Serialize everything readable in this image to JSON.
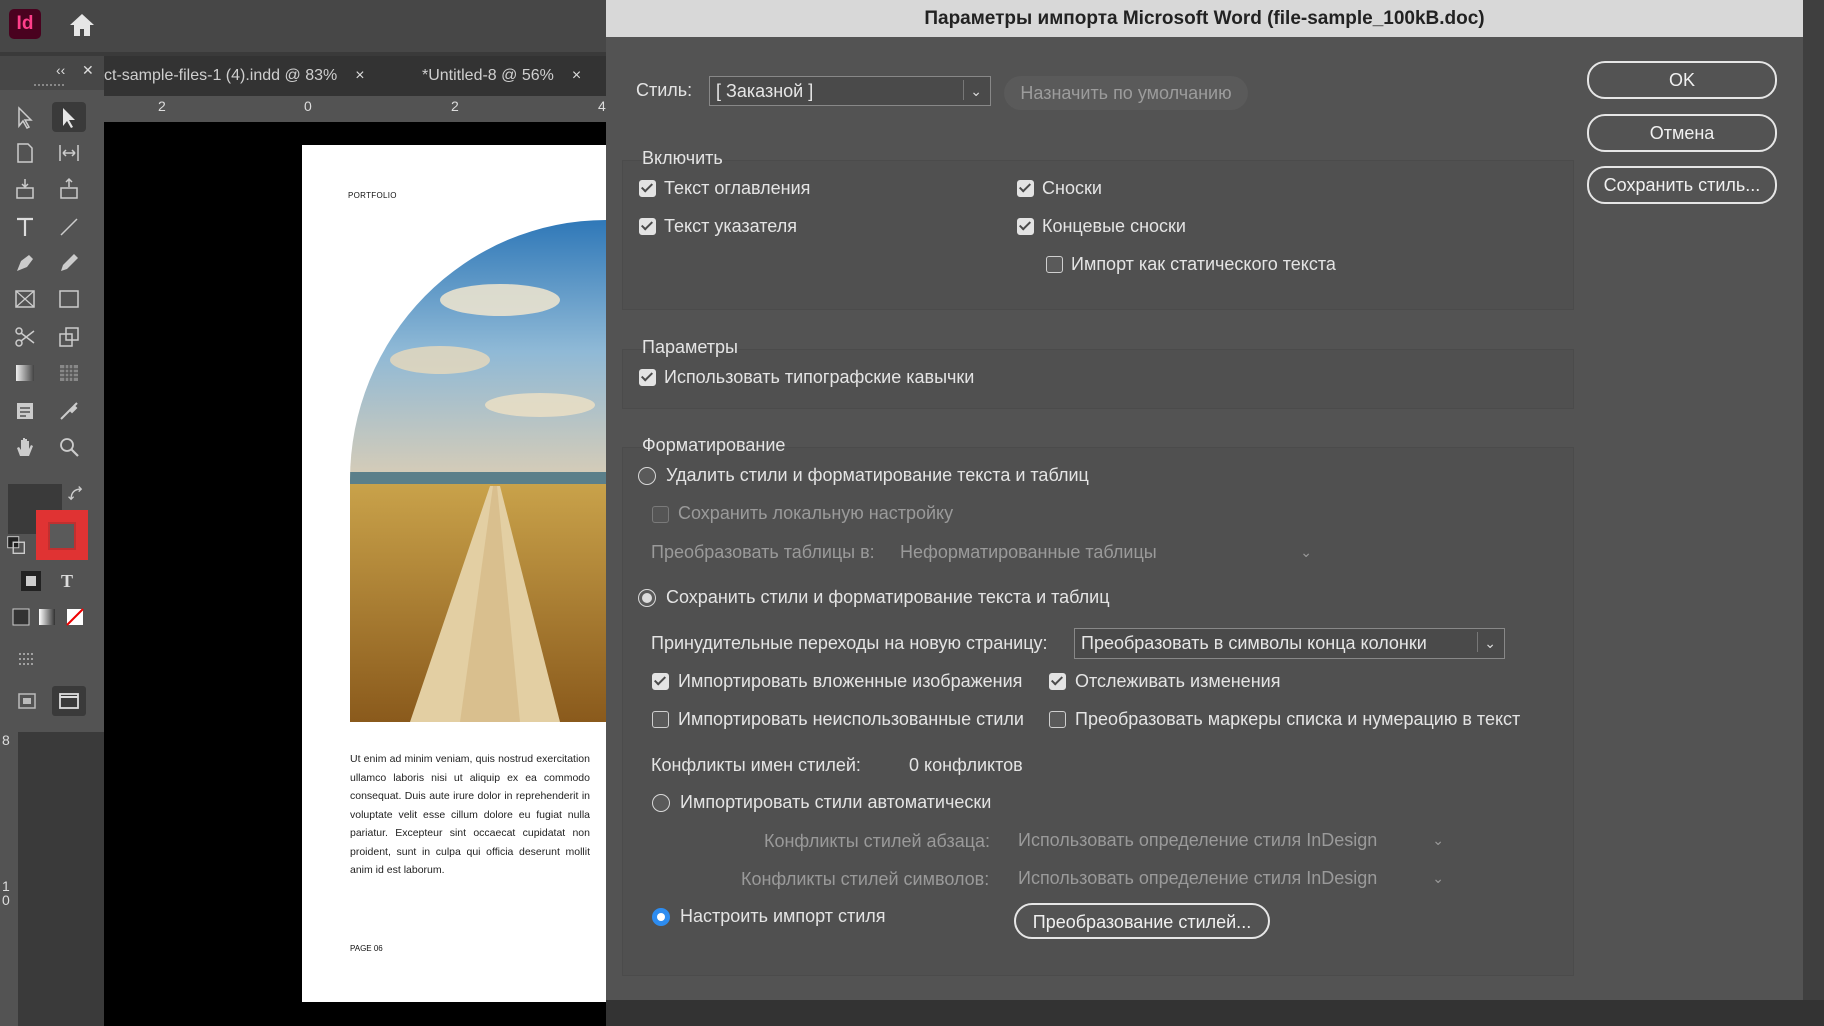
{
  "app": {
    "logo": "Id",
    "tabs": [
      {
        "label": "ct-sample-files-1 (4).indd @ 83%",
        "close": "×"
      },
      {
        "label": "*Untitled-8 @ 56%",
        "close": "×"
      }
    ],
    "ruler_top": [
      "2",
      "0",
      "2",
      "4"
    ],
    "ruler_left": [
      "8",
      "1",
      "0"
    ],
    "panel_controls": {
      "collapse": "‹‹",
      "close": "✕"
    },
    "type_tool_glyph": "T",
    "page": {
      "header": "PORTFOLIO",
      "body": "Ut enim ad minim veniam, quis nostrud exercitation ullamco laboris nisi ut aliquip ex ea commodo consequat. Duis aute irure dolor in reprehenderit in voluptate velit esse cillum dolore eu fugiat nulla pariatur. Excepteur sint occaecat cupidatat non proident, sunt in culpa qui officia deserunt mollit anim id est laborum.",
      "footer": "PAGE 06"
    }
  },
  "dialog": {
    "title": "Параметры импорта Microsoft Word (file-sample_100kB.doc)",
    "style_label": "Стиль:",
    "style_value": "[ Заказной ]",
    "set_default_label": "Назначить по умолчанию",
    "buttons": {
      "ok": "OK",
      "cancel": "Отмена",
      "save_style": "Сохранить стиль..."
    },
    "include": {
      "heading": "Включить",
      "toc_text": {
        "label": "Текст оглавления",
        "checked": true
      },
      "index_text": {
        "label": "Текст указателя",
        "checked": true
      },
      "footnotes": {
        "label": "Сноски",
        "checked": true
      },
      "endnotes": {
        "label": "Концевые сноски",
        "checked": true
      },
      "static_text": {
        "label": "Импорт как статического текста",
        "checked": false
      }
    },
    "options": {
      "heading": "Параметры",
      "typographer_quotes": {
        "label": "Использовать типографские кавычки",
        "checked": true
      }
    },
    "formatting": {
      "heading": "Форматирование",
      "remove_styles": {
        "label": "Удалить стили и форматирование текста и таблиц",
        "selected": false
      },
      "preserve_local": {
        "label": "Сохранить локальную настройку",
        "checked": false,
        "disabled": true
      },
      "convert_tables_label": "Преобразовать таблицы в:",
      "convert_tables_value": "Неформатированные таблицы",
      "preserve_styles": {
        "label": "Сохранить стили и форматирование текста и таблиц",
        "selected": true
      },
      "page_breaks_label": "Принудительные переходы на новую страницу:",
      "page_breaks_value": "Преобразовать в символы конца колонки",
      "import_inline_graphics": {
        "label": "Импортировать вложенные изображения",
        "checked": true
      },
      "track_changes": {
        "label": "Отслеживать изменения",
        "checked": true
      },
      "import_unused_styles": {
        "label": "Импортировать неиспользованные стили",
        "checked": false
      },
      "convert_bullets": {
        "label": "Преобразовать маркеры списка и нумерацию в текст",
        "checked": false
      },
      "name_conflicts_label": "Конфликты имен стилей:",
      "name_conflicts_value": "0 конфликтов",
      "auto_import": {
        "label": "Импортировать стили автоматически",
        "selected": false
      },
      "paragraph_conflicts_label": "Конфликты стилей абзаца:",
      "paragraph_conflicts_value": "Использовать определение стиля InDesign",
      "character_conflicts_label": "Конфликты стилей символов:",
      "character_conflicts_value": "Использовать определение стиля InDesign",
      "customize_import": {
        "label": "Настроить импорт стиля",
        "selected": true
      },
      "style_mapping_button": "Преобразование стилей..."
    }
  }
}
